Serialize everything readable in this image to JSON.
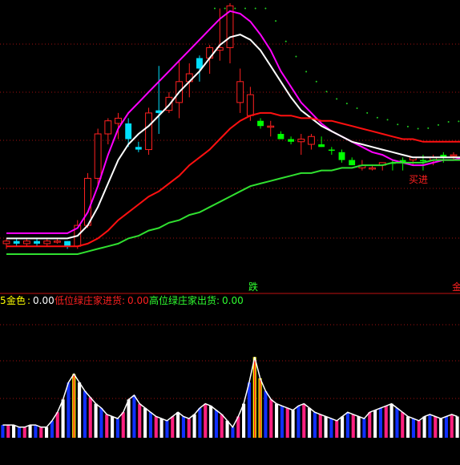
{
  "colors": {
    "background": "#000000",
    "grid": "#a01010",
    "separator": "#c01010",
    "candle_up": "#ff2020",
    "candle_down": "#00e0ff",
    "candle_green": "#00ff00",
    "ma_magenta": "#ff00ff",
    "ma_white": "#ffffff",
    "ma_red": "#ff1010",
    "ma_green": "#30e030",
    "dots": "#20d020",
    "vol_pink": "#ff2080",
    "vol_blue": "#1030ff",
    "vol_white": "#ffffff",
    "vol_yellow": "#ffff00",
    "vol_white_line": "#ffffff"
  },
  "price_panel": {
    "y_range": [
      0,
      100
    ],
    "marks": {
      "die_label": "跌",
      "buy_signal_label": "买进",
      "right_edge_char": "金"
    }
  },
  "indicator_bar": {
    "partial_char": "5",
    "items": [
      {
        "label": "金色",
        "value": "0.00",
        "color": "#ffffff"
      },
      {
        "label": "低位绿庄家进货",
        "value": "0.00",
        "color": "#ff2020"
      },
      {
        "label": "高位绿庄家出货",
        "value": "0.00",
        "color": "#30ff30"
      }
    ]
  },
  "chart_data": [
    {
      "type": "candlestick",
      "title": "",
      "x": [
        0,
        1,
        2,
        3,
        4,
        5,
        6,
        7,
        8,
        9,
        10,
        11,
        12,
        13,
        14,
        15,
        16,
        17,
        18,
        19,
        20,
        21,
        22,
        23,
        24,
        25,
        26,
        27,
        28,
        29,
        30,
        31,
        32,
        33,
        34,
        35,
        36,
        37,
        38,
        39,
        40,
        41,
        42,
        43,
        44,
        45,
        46,
        47
      ],
      "candles": [
        {
          "o": 8,
          "h": 10,
          "l": 6,
          "c": 9,
          "t": "up"
        },
        {
          "o": 9,
          "h": 10,
          "l": 7,
          "c": 8,
          "t": "down"
        },
        {
          "o": 8,
          "h": 10,
          "l": 7,
          "c": 9,
          "t": "up"
        },
        {
          "o": 9,
          "h": 10,
          "l": 7,
          "c": 8,
          "t": "down"
        },
        {
          "o": 8,
          "h": 10,
          "l": 7,
          "c": 9,
          "t": "up"
        },
        {
          "o": 9,
          "h": 10,
          "l": 8,
          "c": 9,
          "t": "up"
        },
        {
          "o": 9,
          "h": 9,
          "l": 6,
          "c": 7,
          "t": "down"
        },
        {
          "o": 7,
          "h": 17,
          "l": 6,
          "c": 15,
          "t": "up"
        },
        {
          "o": 15,
          "h": 35,
          "l": 14,
          "c": 33,
          "t": "up"
        },
        {
          "o": 33,
          "h": 52,
          "l": 30,
          "c": 50,
          "t": "up"
        },
        {
          "o": 50,
          "h": 56,
          "l": 46,
          "c": 55,
          "t": "up"
        },
        {
          "o": 56,
          "h": 58,
          "l": 48,
          "c": 54,
          "t": "up"
        },
        {
          "o": 54,
          "h": 56,
          "l": 45,
          "c": 48,
          "t": "down"
        },
        {
          "o": 45,
          "h": 47,
          "l": 43,
          "c": 44,
          "t": "down"
        },
        {
          "o": 44,
          "h": 60,
          "l": 42,
          "c": 58,
          "t": "up"
        },
        {
          "o": 58,
          "h": 76,
          "l": 50,
          "c": 59,
          "t": "down"
        },
        {
          "o": 59,
          "h": 66,
          "l": 58,
          "c": 64,
          "t": "up"
        },
        {
          "o": 62,
          "h": 78,
          "l": 56,
          "c": 70,
          "t": "up"
        },
        {
          "o": 70,
          "h": 77,
          "l": 64,
          "c": 73,
          "t": "up"
        },
        {
          "o": 75,
          "h": 80,
          "l": 70,
          "c": 79,
          "t": "down"
        },
        {
          "o": 79,
          "h": 84,
          "l": 73,
          "c": 83,
          "t": "up"
        },
        {
          "o": 82,
          "h": 98,
          "l": 78,
          "c": 83,
          "t": "up"
        },
        {
          "o": 83,
          "h": 100,
          "l": 77,
          "c": 99,
          "t": "up"
        },
        {
          "o": 70,
          "h": 75,
          "l": 58,
          "c": 62,
          "t": "up"
        },
        {
          "o": 65,
          "h": 68,
          "l": 55,
          "c": 57,
          "t": "up"
        },
        {
          "o": 55,
          "h": 56,
          "l": 52,
          "c": 53,
          "t": "green"
        },
        {
          "o": 53,
          "h": 55,
          "l": 49,
          "c": 53,
          "t": "up"
        },
        {
          "o": 50,
          "h": 51,
          "l": 48,
          "c": 48,
          "t": "green"
        },
        {
          "o": 48,
          "h": 49,
          "l": 46,
          "c": 47,
          "t": "green"
        },
        {
          "o": 48,
          "h": 50,
          "l": 42,
          "c": 47,
          "t": "up"
        },
        {
          "o": 49,
          "h": 50,
          "l": 44,
          "c": 46,
          "t": "up"
        },
        {
          "o": 46,
          "h": 49,
          "l": 45,
          "c": 45,
          "t": "green"
        },
        {
          "o": 44,
          "h": 45,
          "l": 42,
          "c": 44,
          "t": "green"
        },
        {
          "o": 43,
          "h": 44,
          "l": 39,
          "c": 40,
          "t": "green"
        },
        {
          "o": 40,
          "h": 41,
          "l": 38,
          "c": 38,
          "t": "green"
        },
        {
          "o": 38,
          "h": 40,
          "l": 36,
          "c": 37,
          "t": "up"
        },
        {
          "o": 37,
          "h": 38,
          "l": 36,
          "c": 37,
          "t": "up"
        },
        {
          "o": 38,
          "h": 39,
          "l": 36,
          "c": 39,
          "t": "up"
        },
        {
          "o": 39,
          "h": 40,
          "l": 36,
          "c": 39,
          "t": "green"
        },
        {
          "o": 39,
          "h": 41,
          "l": 36,
          "c": 40,
          "t": "green"
        },
        {
          "o": 40,
          "h": 41,
          "l": 38,
          "c": 41,
          "t": "up"
        },
        {
          "o": 40,
          "h": 42,
          "l": 36,
          "c": 40,
          "t": "green"
        },
        {
          "o": 40,
          "h": 42,
          "l": 38,
          "c": 41,
          "t": "up"
        },
        {
          "o": 41,
          "h": 43,
          "l": 39,
          "c": 42,
          "t": "green"
        },
        {
          "o": 42,
          "h": 43,
          "l": 40,
          "c": 42,
          "t": "up"
        }
      ],
      "series": [
        {
          "values": [
            12,
            12,
            12,
            12,
            12,
            12,
            12,
            14,
            20,
            30,
            42,
            52,
            58,
            62,
            66,
            70,
            74,
            78,
            82,
            86,
            90,
            94,
            97,
            96,
            93,
            88,
            82,
            74,
            68,
            62,
            58,
            54,
            51,
            49,
            47,
            45,
            43,
            42,
            40,
            39,
            38,
            38,
            39,
            40,
            40,
            41,
            41,
            42
          ],
          "color": "#ff00ff"
        },
        {
          "values": [
            10,
            10,
            10,
            10,
            10,
            10,
            10,
            11,
            15,
            22,
            31,
            40,
            46,
            50,
            53,
            57,
            61,
            66,
            70,
            74,
            79,
            84,
            87,
            88,
            86,
            82,
            76,
            70,
            64,
            59,
            56,
            53,
            51,
            49,
            47,
            46,
            45,
            44,
            43,
            42,
            41,
            41,
            41,
            41,
            41,
            41,
            42,
            42
          ],
          "color": "#ffffff"
        },
        {
          "values": [
            7,
            7,
            7,
            7,
            7,
            7,
            7,
            7,
            8,
            10,
            13,
            17,
            20,
            23,
            26,
            28,
            31,
            34,
            38,
            41,
            44,
            48,
            52,
            55,
            57,
            58,
            58,
            57,
            57,
            56,
            56,
            55,
            55,
            54,
            53,
            52,
            51,
            50,
            49,
            48,
            48,
            47,
            47,
            47,
            47,
            47,
            47,
            47
          ],
          "color": "#ff1010"
        },
        {
          "values": [
            4,
            4,
            4,
            4,
            4,
            4,
            4,
            4,
            5,
            6,
            7,
            8,
            10,
            11,
            13,
            14,
            16,
            17,
            19,
            20,
            22,
            24,
            26,
            28,
            30,
            31,
            32,
            33,
            34,
            35,
            35,
            36,
            36,
            37,
            37,
            38,
            38,
            38,
            39,
            39,
            39,
            39,
            40,
            40,
            40,
            40,
            40,
            40
          ],
          "color": "#30e030"
        }
      ],
      "ylim": [
        0,
        100
      ]
    },
    {
      "type": "bar",
      "title": "",
      "values": [
        6,
        6,
        6,
        5,
        5,
        6,
        6,
        5,
        5,
        8,
        12,
        18,
        26,
        30,
        26,
        22,
        19,
        16,
        14,
        11,
        10,
        9,
        12,
        18,
        20,
        16,
        14,
        12,
        10,
        9,
        8,
        10,
        12,
        10,
        9,
        11,
        14,
        16,
        15,
        13,
        11,
        8,
        5,
        10,
        16,
        26,
        38,
        28,
        22,
        18,
        16,
        15,
        14,
        13,
        15,
        16,
        14,
        12,
        11,
        10,
        9,
        8,
        10,
        12,
        11,
        10,
        9,
        12,
        13,
        14,
        15,
        16,
        14,
        12,
        10,
        9,
        8,
        10,
        11,
        10,
        9,
        10,
        11,
        10
      ],
      "ylim": [
        0,
        40
      ]
    }
  ]
}
